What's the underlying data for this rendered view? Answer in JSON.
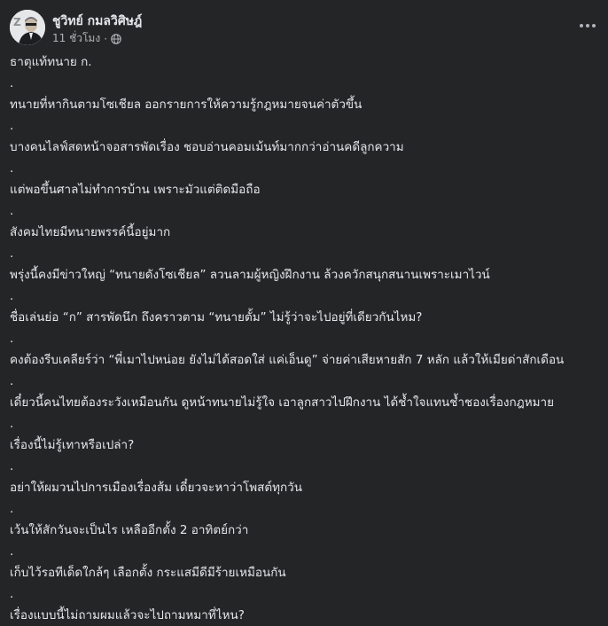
{
  "post": {
    "author_name": "ชูวิทย์ กมลวิศิษฎ์",
    "timestamp": "11 ชั่วโมง",
    "separator": "·",
    "privacy_icon": "globe-icon",
    "more_icon": "more-options-icon",
    "lines": [
      "ธาตุแท้ทนาย ก.",
      ".",
      "ทนายที่หากินตามโซเชียล ออกรายการให้ความรู้กฎหมายจนค่าตัวขึ้น",
      ".",
      "บางคนไลฟ์สดหน้าจอสารพัดเรื่อง ชอบอ่านคอมเม้นท์มากกว่าอ่านคดีลูกความ",
      ".",
      "แต่พอขึ้นศาลไม่ทำการบ้าน เพราะมัวแต่ติดมือถือ",
      ".",
      "สังคมไทยมีทนายพรรค์นี้อยู่มาก",
      ".",
      "พรุ่งนี้คงมีข่าวใหญ่ “ทนายดังโซเชียล” ลวนลามผู้หญิงฝึกงาน ล้วงควักสนุกสนานเพราะเมาไวน์",
      ".",
      "ชื่อเล่นย่อ “ก” สารพัดนึก ถึงคราวตาม “ทนายตั้ม” ไม่รู้ว่าจะไปอยู่ที่เดียวกันไหม?",
      ".",
      "คงต้องรีบเคลียร์ว่า “พี่เมาไปหน่อย ยังไม่ได้สอดใส่ แค่เอ็นดู” จ่ายค่าเสียหายสัก 7 หลัก แล้วให้เมียด่าสักเดือน",
      ".",
      "เดี๋ยวนี้คนไทยต้องระวังเหมือนกัน ดูหน้าทนายไม่รู้ใจ เอาลูกสาวไปฝึกงาน ได้ช้ำใจแทนช้ำชองเรื่องกฎหมาย",
      ".",
      "เรื่องนี้ไม่รู้เทาหรือเปล่า?",
      ".",
      "อย่าให้ผมวนไปการเมืองเรื่องส้ม เดี๋ยวจะหาว่าโพสต์ทุกวัน",
      ".",
      "เว้นให้สักวันจะเป็นไร เหลืออีกตั้ง 2 อาทิตย์กว่า",
      ".",
      "เก็บไว้รอทีเด็ดใกล้ๆ เลือกตั้ง กระแสมีดีมีร้ายเหมือนกัน",
      ".",
      "เรื่องแบบนี้ไม่ถามผมแล้วจะไปถามหมาที่ไหน?"
    ]
  },
  "colors": {
    "background": "#242526",
    "text_primary": "#e4e6eb",
    "text_secondary": "#b0b3b8"
  }
}
